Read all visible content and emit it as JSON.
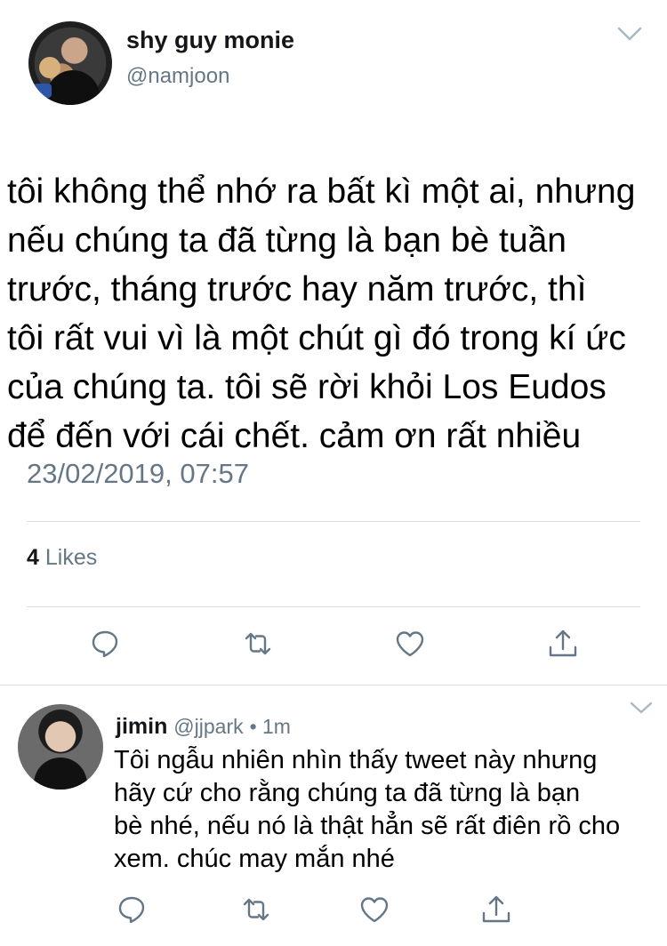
{
  "tweet": {
    "display_name": "shy guy monie",
    "handle": "@namjoon",
    "text": "tôi không thể nhớ ra bất kì một ai, nhưng\nnếu chúng ta đã từng là bạn bè tuần\ntrước, tháng trước hay năm trước, thì\ntôi rất vui vì là một chút gì đó trong kí ức\ncủa chúng ta. tôi sẽ rời khỏi Los Eudos\nđể đến với cái chết. cảm ơn rất nhiều",
    "timestamp": "23/02/2019, 07:57",
    "likes_count": "4",
    "likes_label": "Likes",
    "icons": [
      "reply-icon",
      "retweet-icon",
      "like-icon",
      "share-icon",
      "chevron-down-icon"
    ]
  },
  "reply": {
    "name": "jimin",
    "handle": "@jjpark",
    "time": "• 1m",
    "text": "Tôi ngẫu nhiên nhìn thấy tweet này nhưng\nhãy cứ cho rằng chúng ta đã từng là bạn\nbè nhé, nếu nó là thật hẳn sẽ rất điên rồ cho\nxem. chúc may mắn nhé",
    "icons": [
      "reply-icon",
      "retweet-icon",
      "like-icon",
      "share-icon",
      "chevron-down-icon"
    ]
  },
  "colors": {
    "text": "#14171a",
    "secondary": "#657786",
    "divider": "#d6dde3",
    "icon": "#657786"
  }
}
